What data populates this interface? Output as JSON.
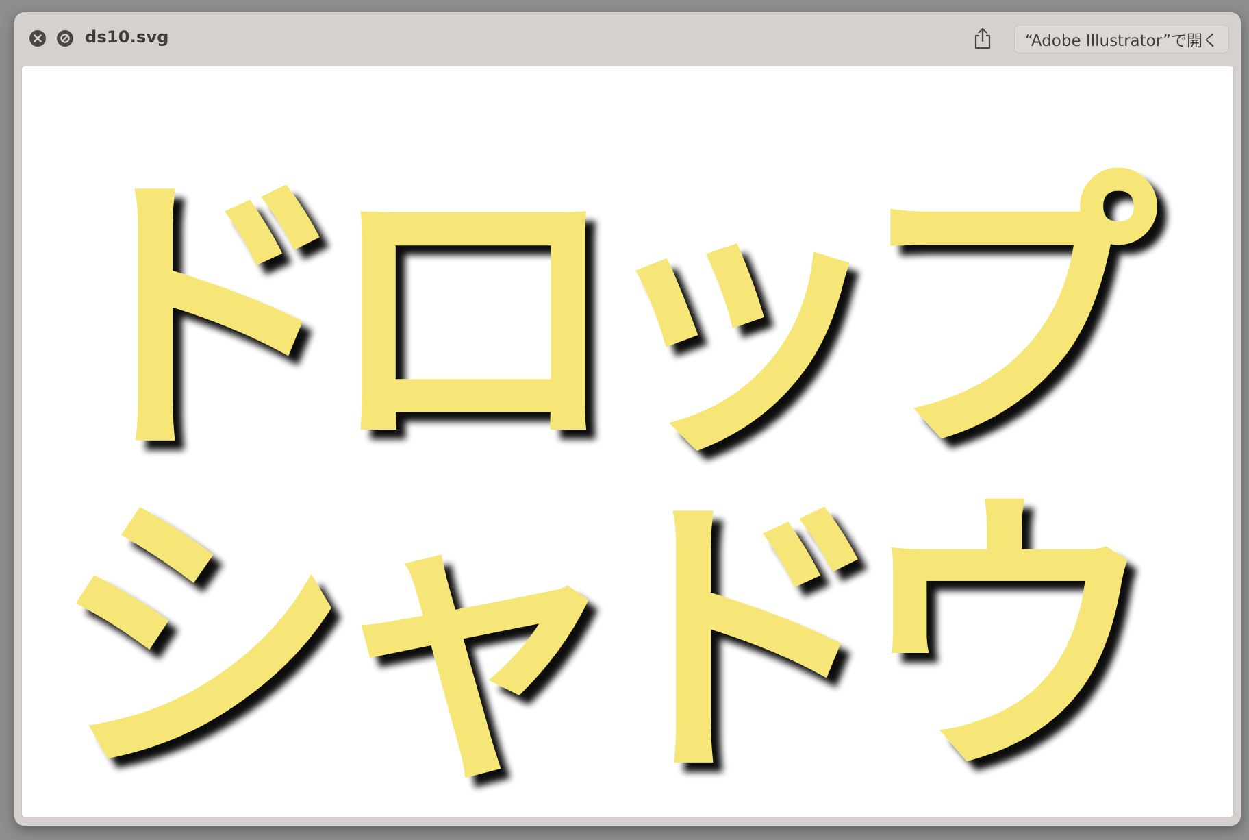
{
  "window": {
    "file_title": "ds10.svg",
    "open_with_label": "“Adobe Illustrator”で開く"
  },
  "icons": {
    "close": "close-icon",
    "block": "block-icon",
    "share": "share-icon"
  },
  "artwork": {
    "line1": [
      "ド",
      "ロ",
      "ッ",
      "プ"
    ],
    "line2": [
      "シ",
      "ャ",
      "ド",
      "ウ"
    ],
    "fill_color": "#f5e677",
    "shadow_color": "#000000"
  }
}
